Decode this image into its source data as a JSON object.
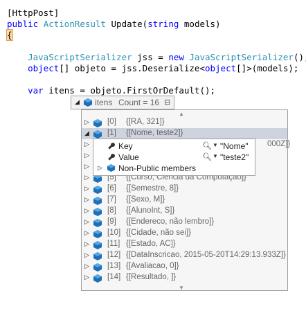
{
  "code": {
    "l1": "[HttpPost]",
    "l2_kw": "public",
    "l2_type": "ActionResult",
    "l2_rest": " Update(",
    "l2_kw2": "string",
    "l2_end": " models)",
    "l3": "{",
    "l5_type": "JavaScriptSerializer",
    "l5_mid": " jss = ",
    "l5_kw": "new",
    "l5_type2": "JavaScriptSerializer",
    "l5_end": "();",
    "l6_kw": "object",
    "l6_mid": "[] objeto = jss.Deserialize<",
    "l6_kw2": "object",
    "l6_end": "[]>(models);",
    "l8_kw": "var",
    "l8_rest": " itens = objeto.FirstOrDefault();"
  },
  "datatip": {
    "name": "itens",
    "count": "Count = 16"
  },
  "rows": [
    {
      "idx": "[0]",
      "val": "{[RA, 321]}"
    },
    {
      "idx": "[1]",
      "val": "{[Nome, teste2]}"
    },
    {
      "idx": "",
      "val": "000Z]}"
    },
    {
      "idx": "",
      "val": ""
    },
    {
      "idx": "",
      "val": ""
    },
    {
      "idx": "[5]",
      "val": "{[Curso, Ciência da Computação]}"
    },
    {
      "idx": "[6]",
      "val": "{[Semestre, 8]}"
    },
    {
      "idx": "[7]",
      "val": "{[Sexo, M]}"
    },
    {
      "idx": "[8]",
      "val": "{[AlunoInt, S]}"
    },
    {
      "idx": "[9]",
      "val": "{[Endereco, não lembro]}"
    },
    {
      "idx": "[10]",
      "val": "{[Cidade, não sei]}"
    },
    {
      "idx": "[11]",
      "val": "{[Estado, AC]}"
    },
    {
      "idx": "[12]",
      "val": "{[DataInscricao, 2015-05-20T14:29:13.933Z]}"
    },
    {
      "idx": "[13]",
      "val": "{[Avaliacao, 0]}"
    },
    {
      "idx": "[14]",
      "val": "{[Resultado, ]}"
    }
  ],
  "sub": {
    "key_label": "Key",
    "key_value": "\"Nome\"",
    "value_label": "Value",
    "value_value": "\"teste2\"",
    "npm_label": "Non-Public members"
  },
  "colors": {
    "keyword": "#0000ff",
    "type": "#2b91af",
    "selection": "#cfd3dd",
    "cube": "#1c6fb8"
  }
}
